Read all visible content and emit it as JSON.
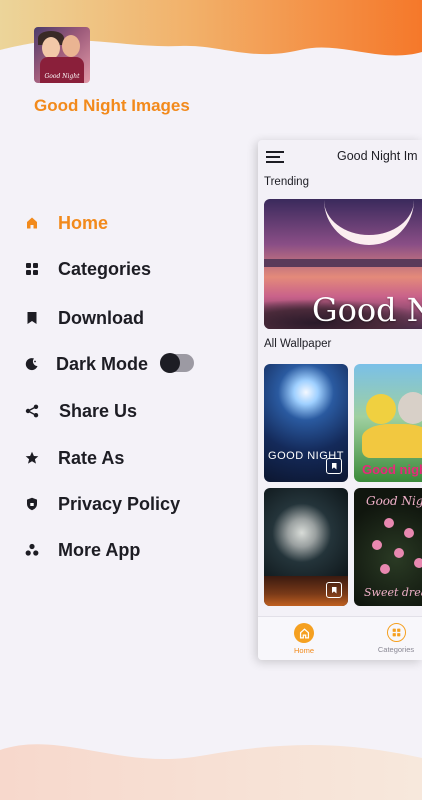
{
  "app": {
    "name": "Good Night Images",
    "logo_text": "Good Night"
  },
  "colors": {
    "accent": "#f28a1c",
    "text": "#1d1d24",
    "background": "#f4f2f8"
  },
  "menu": {
    "items": [
      {
        "label": "Home",
        "icon": "home-icon",
        "active": true
      },
      {
        "label": "Categories",
        "icon": "grid-icon",
        "active": false
      },
      {
        "label": "Download",
        "icon": "bookmark-icon",
        "active": false
      },
      {
        "label": "Dark Mode",
        "icon": "moon-icon",
        "active": false,
        "toggle_on": false
      },
      {
        "label": "Share Us",
        "icon": "share-icon",
        "active": false
      },
      {
        "label": "Rate As",
        "icon": "star-icon",
        "active": false
      },
      {
        "label": "Privacy Policy",
        "icon": "shield-icon",
        "active": false
      },
      {
        "label": "More App",
        "icon": "apps-icon",
        "active": false
      }
    ]
  },
  "preview": {
    "title": "Good Night Im",
    "trending_label": "Trending",
    "trending_text": "Good N",
    "all_wallpaper_label": "All Wallpaper",
    "cards": [
      {
        "text": "GOOD NIGHT"
      },
      {
        "text": "Good nigh"
      },
      {
        "text": ""
      },
      {
        "text_top": "Good Nigh",
        "text_bottom": "Sweet drea"
      }
    ],
    "nav": {
      "home_label": "Home",
      "categories_label": "Categories"
    }
  }
}
